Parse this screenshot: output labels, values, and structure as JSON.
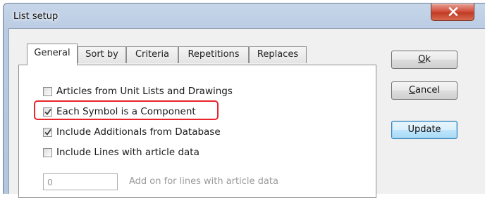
{
  "window": {
    "title": "List setup"
  },
  "tabs": [
    {
      "label": "General",
      "active": true
    },
    {
      "label": "Sort by",
      "active": false
    },
    {
      "label": "Criteria",
      "active": false
    },
    {
      "label": "Repetitions",
      "active": false
    },
    {
      "label": "Replaces",
      "active": false
    }
  ],
  "options": [
    {
      "label": "Articles from Unit Lists and Drawings",
      "checked": false
    },
    {
      "label": "Each Symbol is a Component",
      "checked": true,
      "highlighted": true
    },
    {
      "label": "Include Additionals from Database",
      "checked": true
    },
    {
      "label": "Include Lines with article data",
      "checked": false
    }
  ],
  "addon": {
    "value": "0",
    "label": "Add on for lines with article data"
  },
  "buttons": {
    "ok_mnemonic": "O",
    "ok_rest": "k",
    "cancel_mnemonic": "C",
    "cancel_rest": "ancel",
    "update": "Update"
  },
  "colors": {
    "highlight": "#e8252a",
    "close_button": "#c13b24",
    "default_button": "#3c7fb1"
  },
  "icons": {
    "close": "close-x-icon",
    "check": "checkmark-icon"
  }
}
